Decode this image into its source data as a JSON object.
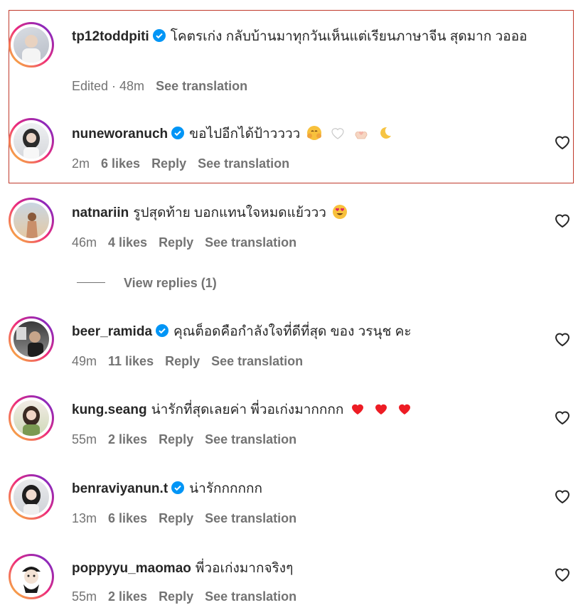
{
  "comments": [
    {
      "username": "tp12toddpiti",
      "verified": true,
      "text": "โคตรเก่ง กลับบ้านมาทุกวันเห็นแต่เรียนภาษาจีน สุดมาก วอออ",
      "time": "Edited · 48m",
      "likes": "",
      "reply": "",
      "see_translation": "See translation",
      "highlighted": true
    },
    {
      "username": "nuneworanuch",
      "verified": true,
      "text": "ขอไปอีกได้ป้าวววว",
      "time": "2m",
      "likes": "6 likes",
      "reply": "Reply",
      "see_translation": "See translation",
      "highlighted": true
    },
    {
      "username": "natnariin",
      "verified": false,
      "text": "รูปสุดท้าย บอกแทนใจหมดแย้ววว",
      "time": "46m",
      "likes": "4 likes",
      "reply": "Reply",
      "see_translation": "See translation"
    },
    {
      "username": "beer_ramida",
      "verified": true,
      "text": "คุณต็อดคือกำลังใจที่ดีที่สุด ของ วรนุช คะ",
      "time": "49m",
      "likes": "11 likes",
      "reply": "Reply",
      "see_translation": "See translation"
    },
    {
      "username": "kung.seang",
      "verified": false,
      "text": "น่ารักที่สุดเลยค่า พี่วอเก่งมากกกก",
      "time": "55m",
      "likes": "2 likes",
      "reply": "Reply",
      "see_translation": "See translation"
    },
    {
      "username": "benraviyanun.t",
      "verified": true,
      "text": "น่ารักกกกกก",
      "time": "13m",
      "likes": "6 likes",
      "reply": "Reply",
      "see_translation": "See translation"
    },
    {
      "username": "poppyyu_maomao",
      "verified": false,
      "text": "พี่วอเก่งมากจริงๆ",
      "time": "55m",
      "likes": "2 likes",
      "reply": "Reply",
      "see_translation": "See translation"
    }
  ],
  "view_replies": "View replies (1)",
  "colors": {
    "verified_blue": "#0095f6",
    "meta_gray": "#737373",
    "highlight_border": "#c0392b",
    "heart_red": "#ed1c24"
  }
}
